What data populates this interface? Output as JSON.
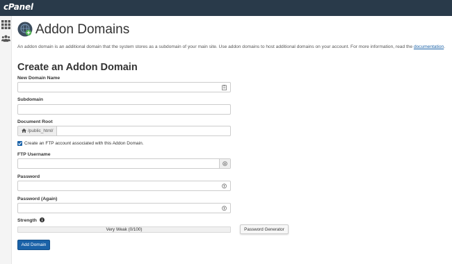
{
  "header": {
    "logo_text": "cPanel"
  },
  "sidebar": {
    "items": [
      {
        "icon": "grid-icon"
      },
      {
        "icon": "users-icon"
      }
    ]
  },
  "page": {
    "title": "Addon Domains",
    "description": "An addon domain is an additional domain that the system stores as a subdomain of your main site. Use addon domains to host additional domains on your account. For more information, read the ",
    "description_link": "documentation",
    "description_end": "."
  },
  "form": {
    "section_title": "Create an Addon Domain",
    "new_domain": {
      "label": "New Domain Name",
      "value": "",
      "icon": "clipboard-icon"
    },
    "subdomain": {
      "label": "Subdomain",
      "value": ""
    },
    "document_root": {
      "label": "Document Root",
      "prefix": "/public_html/",
      "prefix_icon": "home-icon",
      "value": ""
    },
    "ftp_checkbox": {
      "label": "Create an FTP account associated with this Addon Domain.",
      "checked": true
    },
    "ftp_username": {
      "label": "FTP Username",
      "value": "",
      "icon": "at-icon"
    },
    "password": {
      "label": "Password",
      "value": "",
      "icon": "key-icon"
    },
    "password_again": {
      "label": "Password (Again)",
      "value": "",
      "icon": "key-icon"
    },
    "strength": {
      "label": "Strength",
      "info_icon": "info-icon",
      "value_text": "Very Weak (0/100)",
      "score": 0
    },
    "password_generator_label": "Password Generator",
    "submit_label": "Add Domain"
  },
  "colors": {
    "topbar": "#293a4a",
    "primary": "#1a62a8",
    "sidebar": "#f4f4f4"
  }
}
